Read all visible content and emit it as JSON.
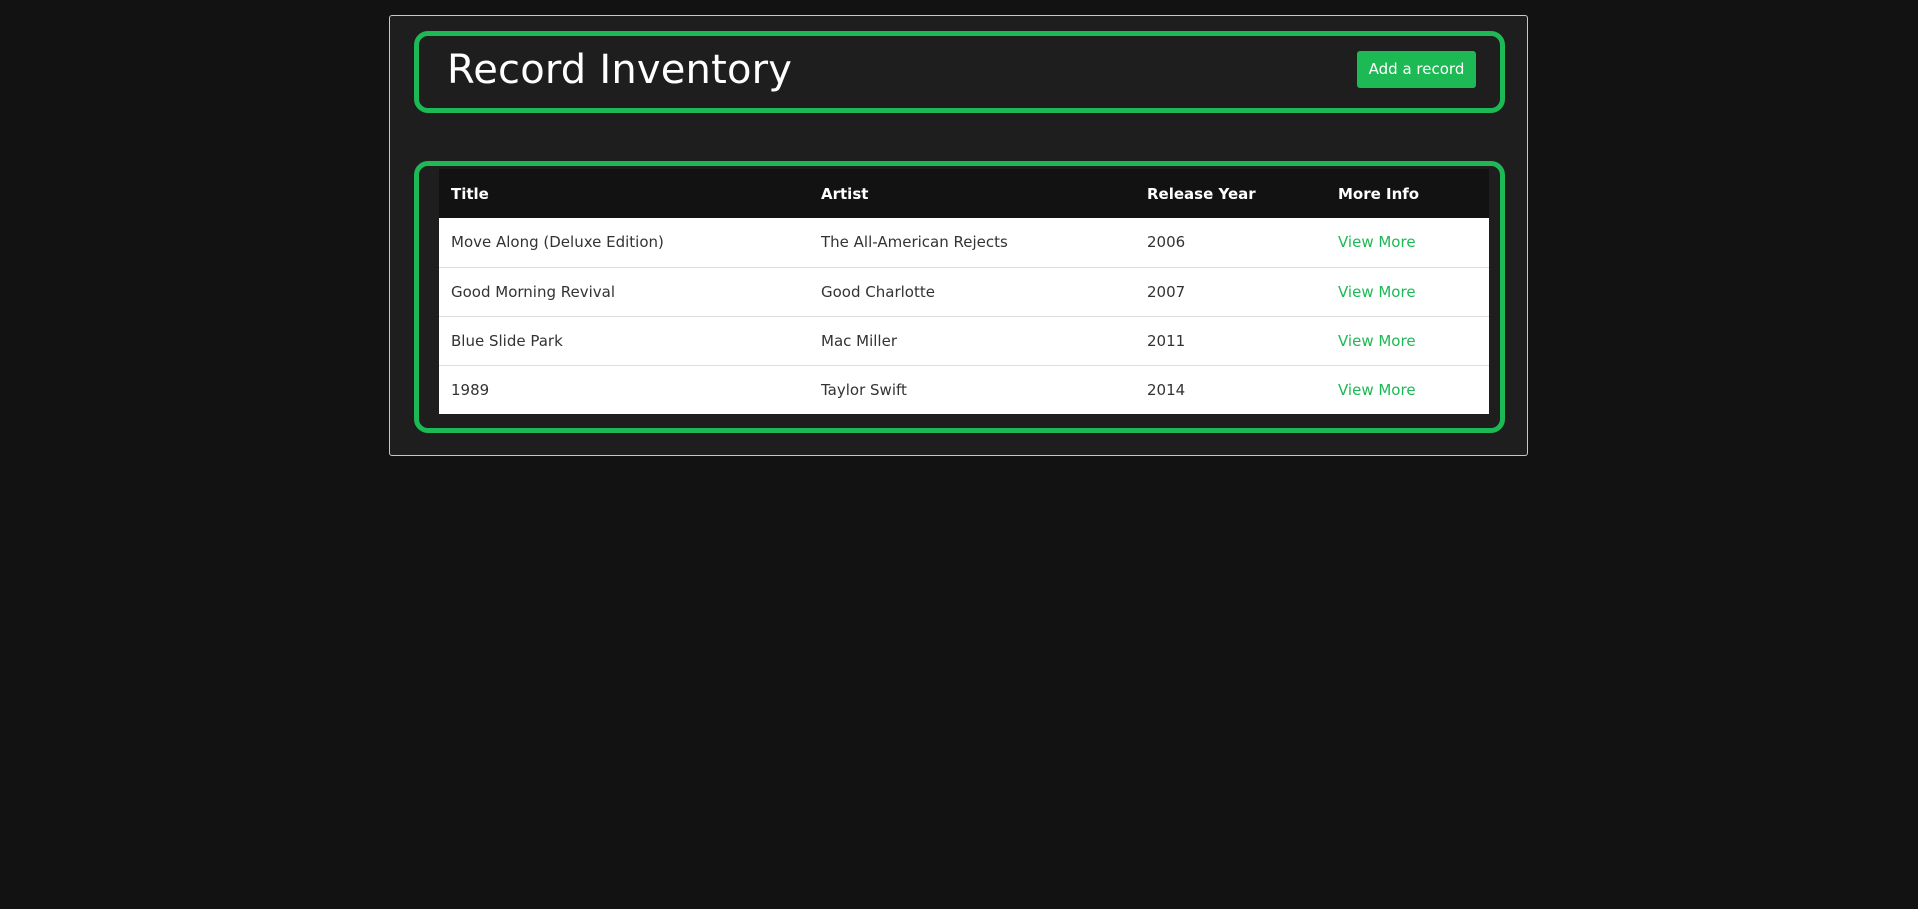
{
  "header": {
    "title": "Record Inventory",
    "add_button_label": "Add a record"
  },
  "table": {
    "columns": [
      "Title",
      "Artist",
      "Release Year",
      "More Info"
    ],
    "rows": [
      {
        "title": "Move Along (Deluxe Edition)",
        "artist": "The All-American Rejects",
        "year": "2006",
        "link": "View More"
      },
      {
        "title": "Good Morning Revival",
        "artist": "Good Charlotte",
        "year": "2007",
        "link": "View More"
      },
      {
        "title": "Blue Slide Park",
        "artist": "Mac Miller",
        "year": "2011",
        "link": "View More"
      },
      {
        "title": "1989",
        "artist": "Taylor Swift",
        "year": "2014",
        "link": "View More"
      }
    ]
  },
  "colors": {
    "accent": "#1db954",
    "page_background": "#121212",
    "panel_background": "#1e1e1e"
  }
}
